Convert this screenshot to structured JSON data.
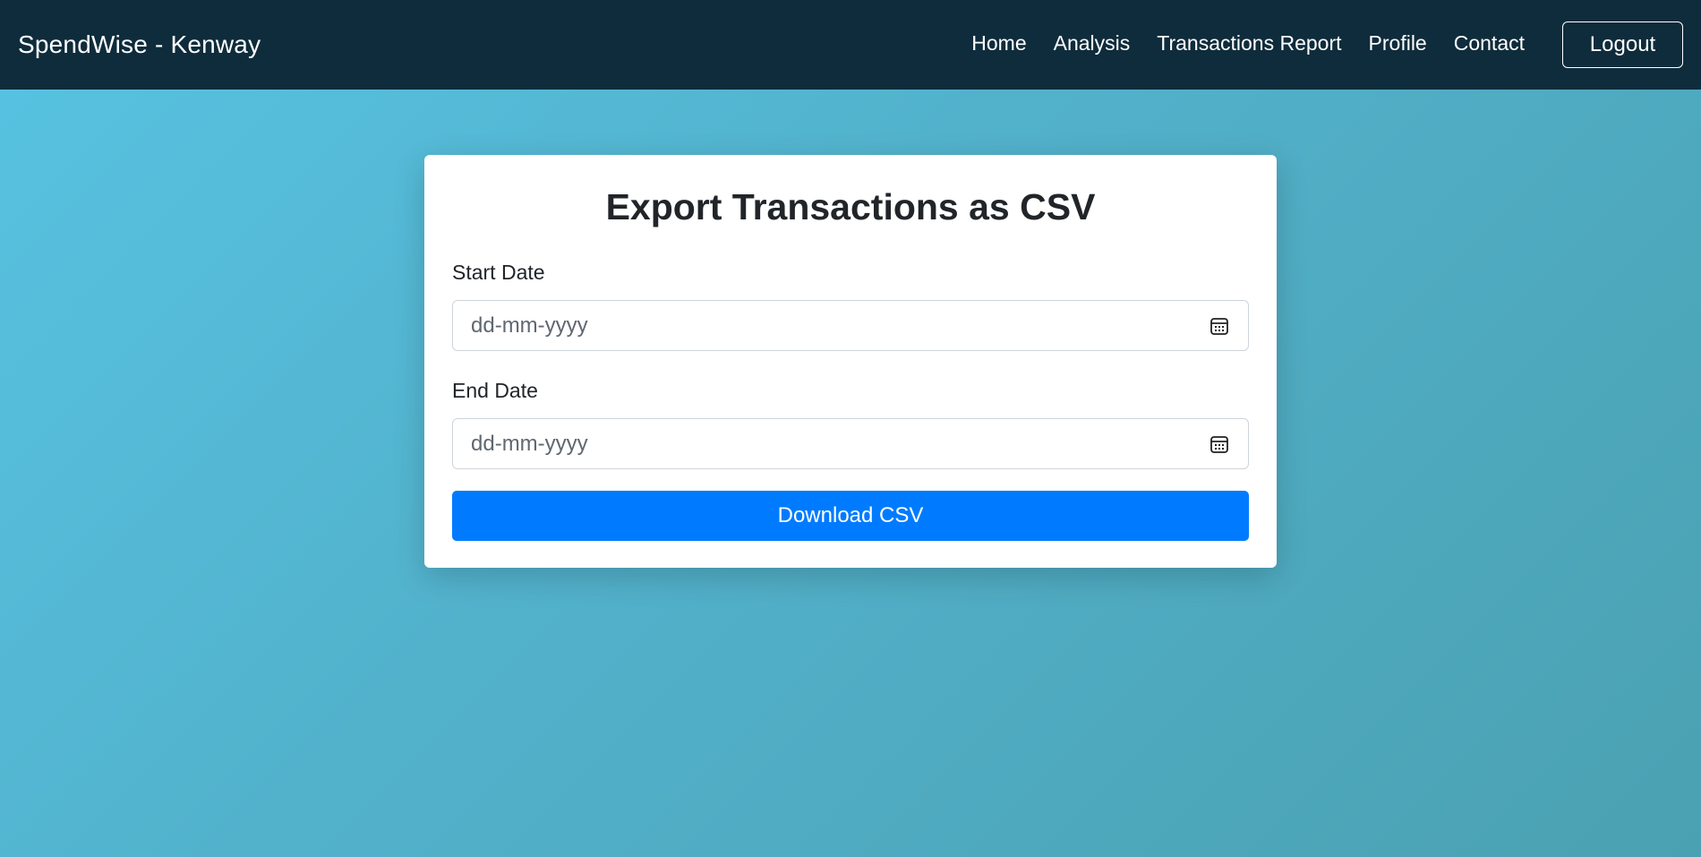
{
  "navbar": {
    "brand": "SpendWise - Kenway",
    "links": [
      {
        "label": "Home"
      },
      {
        "label": "Analysis"
      },
      {
        "label": "Transactions Report"
      },
      {
        "label": "Profile"
      },
      {
        "label": "Contact"
      }
    ],
    "logout_label": "Logout"
  },
  "card": {
    "title": "Export Transactions as CSV",
    "start_date": {
      "label": "Start Date",
      "placeholder": "dd-mm-yyyy",
      "value": "",
      "icon": "calendar-icon"
    },
    "end_date": {
      "label": "End Date",
      "placeholder": "dd-mm-yyyy",
      "value": "",
      "icon": "calendar-icon"
    },
    "download_label": "Download CSV"
  },
  "colors": {
    "navbar_bg": "#0f2c3c",
    "page_bg_start": "#57c3e2",
    "page_bg_end": "#4aa1b1",
    "button_primary": "#007bff",
    "card_bg": "#ffffff",
    "text_dark": "#212529"
  }
}
